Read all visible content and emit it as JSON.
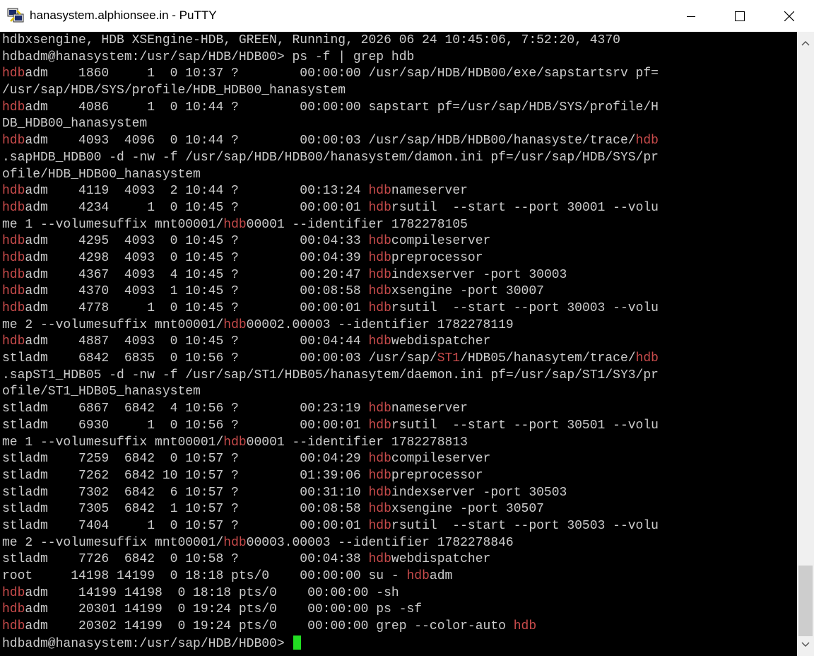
{
  "window": {
    "title": "hanasystem.alphionsee.in - PuTTY",
    "icons": {
      "app": "putty-icon",
      "minimize": "minimize-icon",
      "maximize": "maximize-icon",
      "close": "close-icon"
    }
  },
  "terminal": {
    "highlight_color": "#c84b4b",
    "cursor_color": "#22dd22",
    "lines": [
      [
        {
          "t": "hdbxsengine, HDB XSEngine-HDB, GREEN, Running, 2026 06 24 10:45:06, 7:52:20, 4370"
        }
      ],
      [
        {
          "t": "hdbadm@hanasystem:/usr/sap/HDB/HDB00> ps -f | grep hdb"
        }
      ],
      [
        {
          "t": "hdb",
          "h": true
        },
        {
          "t": "adm    1860     1  0 10:37 ?        00:00:00 /usr/sap/HDB/HDB00/exe/sapstartsrv pf="
        }
      ],
      [
        {
          "t": "/usr/sap/HDB/SYS/profile/HDB_HDB00_hanasystem"
        }
      ],
      [
        {
          "t": "hdb",
          "h": true
        },
        {
          "t": "adm    4086     1  0 10:44 ?        00:00:00 sapstart pf=/usr/sap/HDB/SYS/profile/H"
        }
      ],
      [
        {
          "t": "DB_HDB00_hanasystem"
        }
      ],
      [
        {
          "t": "hdb",
          "h": true
        },
        {
          "t": "adm    4093  4096  0 10:44 ?        00:00:03 /usr/sap/HDB/HDB00/hanasyste/trace/"
        },
        {
          "t": "hdb",
          "h": true
        }
      ],
      [
        {
          "t": ".sapHDB_HDB00 -d -nw -f /usr/sap/HDB/HDB00/hanasystem/damon.ini pf=/usr/sap/HDB/SYS/pr"
        }
      ],
      [
        {
          "t": "ofile/HDB_HDB00_hanasystem"
        }
      ],
      [
        {
          "t": "hdb",
          "h": true
        },
        {
          "t": "adm    4119  4093  2 10:44 ?        00:13:24 "
        },
        {
          "t": "hdb",
          "h": true
        },
        {
          "t": "nameserver"
        }
      ],
      [
        {
          "t": "hdb",
          "h": true
        },
        {
          "t": "adm    4234     1  0 10:45 ?        00:00:01 "
        },
        {
          "t": "hdb",
          "h": true
        },
        {
          "t": "rsutil  --start --port 30001 --volu"
        }
      ],
      [
        {
          "t": "me 1 --volumesuffix mnt00001/"
        },
        {
          "t": "hdb",
          "h": true
        },
        {
          "t": "00001 --identifier 1782278105"
        }
      ],
      [
        {
          "t": "hdb",
          "h": true
        },
        {
          "t": "adm    4295  4093  0 10:45 ?        00:04:33 "
        },
        {
          "t": "hdb",
          "h": true
        },
        {
          "t": "compileserver"
        }
      ],
      [
        {
          "t": "hdb",
          "h": true
        },
        {
          "t": "adm    4298  4093  0 10:45 ?        00:04:39 "
        },
        {
          "t": "hdb",
          "h": true
        },
        {
          "t": "preprocessor"
        }
      ],
      [
        {
          "t": "hdb",
          "h": true
        },
        {
          "t": "adm    4367  4093  4 10:45 ?        00:20:47 "
        },
        {
          "t": "hdb",
          "h": true
        },
        {
          "t": "indexserver -port 30003"
        }
      ],
      [
        {
          "t": "hdb",
          "h": true
        },
        {
          "t": "adm    4370  4093  1 10:45 ?        00:08:58 "
        },
        {
          "t": "hdb",
          "h": true
        },
        {
          "t": "xsengine -port 30007"
        }
      ],
      [
        {
          "t": "hdb",
          "h": true
        },
        {
          "t": "adm    4778     1  0 10:45 ?        00:00:01 "
        },
        {
          "t": "hdb",
          "h": true
        },
        {
          "t": "rsutil  --start --port 30003 --volu"
        }
      ],
      [
        {
          "t": "me 2 --volumesuffix mnt00001/"
        },
        {
          "t": "hdb",
          "h": true
        },
        {
          "t": "00002.00003 --identifier 1782278119"
        }
      ],
      [
        {
          "t": "hdb",
          "h": true
        },
        {
          "t": "adm    4887  4093  0 10:45 ?        00:04:44 "
        },
        {
          "t": "hdb",
          "h": true
        },
        {
          "t": "webdispatcher"
        }
      ],
      [
        {
          "t": "stladm    6842  6835  0 10:56 ?        00:00:03 /usr/sap/"
        },
        {
          "t": "ST1",
          "h": true
        },
        {
          "t": "/HDB05/hanasytem/trace/"
        },
        {
          "t": "hdb",
          "h": true
        }
      ],
      [
        {
          "t": ".sapST1_HDB05 -d -nw -f /usr/sap/ST1/HDB05/hanasytem/daemon.ini pf=/usr/sap/ST1/SY3/pr"
        }
      ],
      [
        {
          "t": "ofile/ST1_HDB05_hanasystem"
        }
      ],
      [
        {
          "t": "stladm    6867  6842  4 10:56 ?        00:23:19 "
        },
        {
          "t": "hdb",
          "h": true
        },
        {
          "t": "nameserver"
        }
      ],
      [
        {
          "t": "stladm    6930     1  0 10:56 ?        00:00:01 "
        },
        {
          "t": "hdb",
          "h": true
        },
        {
          "t": "rsutil  --start --port 30501 --volu"
        }
      ],
      [
        {
          "t": "me 1 --volumesuffix mnt00001/"
        },
        {
          "t": "hdb",
          "h": true
        },
        {
          "t": "00001 --identifier 1782278813"
        }
      ],
      [
        {
          "t": "stladm    7259  6842  0 10:57 ?        00:04:29 "
        },
        {
          "t": "hdb",
          "h": true
        },
        {
          "t": "compileserver"
        }
      ],
      [
        {
          "t": "stladm    7262  6842 10 10:57 ?        01:39:06 "
        },
        {
          "t": "hdb",
          "h": true
        },
        {
          "t": "preprocessor"
        }
      ],
      [
        {
          "t": "stladm    7302  6842  6 10:57 ?        00:31:10 "
        },
        {
          "t": "hdb",
          "h": true
        },
        {
          "t": "indexserver -port 30503"
        }
      ],
      [
        {
          "t": "stladm    7305  6842  1 10:57 ?        00:08:58 "
        },
        {
          "t": "hdb",
          "h": true
        },
        {
          "t": "xsengine -port 30507"
        }
      ],
      [
        {
          "t": "stladm    7404     1  0 10:57 ?        00:00:01 "
        },
        {
          "t": "hdb",
          "h": true
        },
        {
          "t": "rsutil  --start --port 30503 --volu"
        }
      ],
      [
        {
          "t": "me 2 --volumesuffix mnt00001/"
        },
        {
          "t": "hdb",
          "h": true
        },
        {
          "t": "00003.00003 --identifier 1782278846"
        }
      ],
      [
        {
          "t": "stladm    7726  6842  0 10:58 ?        00:04:38 "
        },
        {
          "t": "hdb",
          "h": true
        },
        {
          "t": "webdispatcher"
        }
      ],
      [
        {
          "t": "root     14198 14199  0 18:18 pts/0    00:00:00 su - "
        },
        {
          "t": "hdb",
          "h": true
        },
        {
          "t": "adm"
        }
      ],
      [
        {
          "t": "hdb",
          "h": true
        },
        {
          "t": "adm    14199 14198  0 18:18 pts/0    00:00:00 -sh"
        }
      ],
      [
        {
          "t": "hdb",
          "h": true
        },
        {
          "t": "adm    20301 14199  0 19:24 pts/0    00:00:00 ps -sf"
        }
      ],
      [
        {
          "t": "hdb",
          "h": true
        },
        {
          "t": "adm    20302 14199  0 19:24 pts/0    00:00:00 grep --color-auto "
        },
        {
          "t": "hdb",
          "h": true
        }
      ],
      [
        {
          "t": "hdbadm@hanasystem:/usr/sap/HDB/HDB00> "
        }
      ]
    ]
  },
  "scrollbar": {
    "up_icon": "scroll-up-arrow-icon",
    "down_icon": "scroll-down-arrow-icon"
  }
}
